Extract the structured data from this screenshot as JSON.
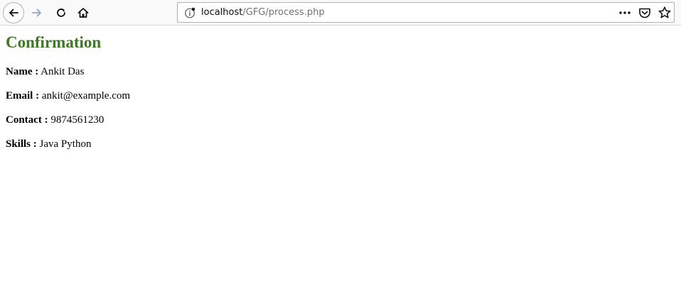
{
  "browser": {
    "url_host": "localhost",
    "url_path": "/GFG/process.php",
    "accent": "#0c0c0d"
  },
  "page": {
    "title": "Confirmation",
    "title_color": "#3b7a23",
    "fields": [
      {
        "label": "Name :",
        "value": " Ankit Das"
      },
      {
        "label": "Email :",
        "value": " ankit@example.com"
      },
      {
        "label": "Contact :",
        "value": " 9874561230"
      },
      {
        "label": "Skills :",
        "value": " Java Python"
      }
    ]
  },
  "icons": {
    "back": "back-arrow-icon",
    "forward": "forward-arrow-icon",
    "reload": "reload-icon",
    "home": "home-icon",
    "info": "info-icon",
    "more": "more-dots-icon",
    "pocket": "pocket-icon",
    "bookmark": "star-icon"
  }
}
